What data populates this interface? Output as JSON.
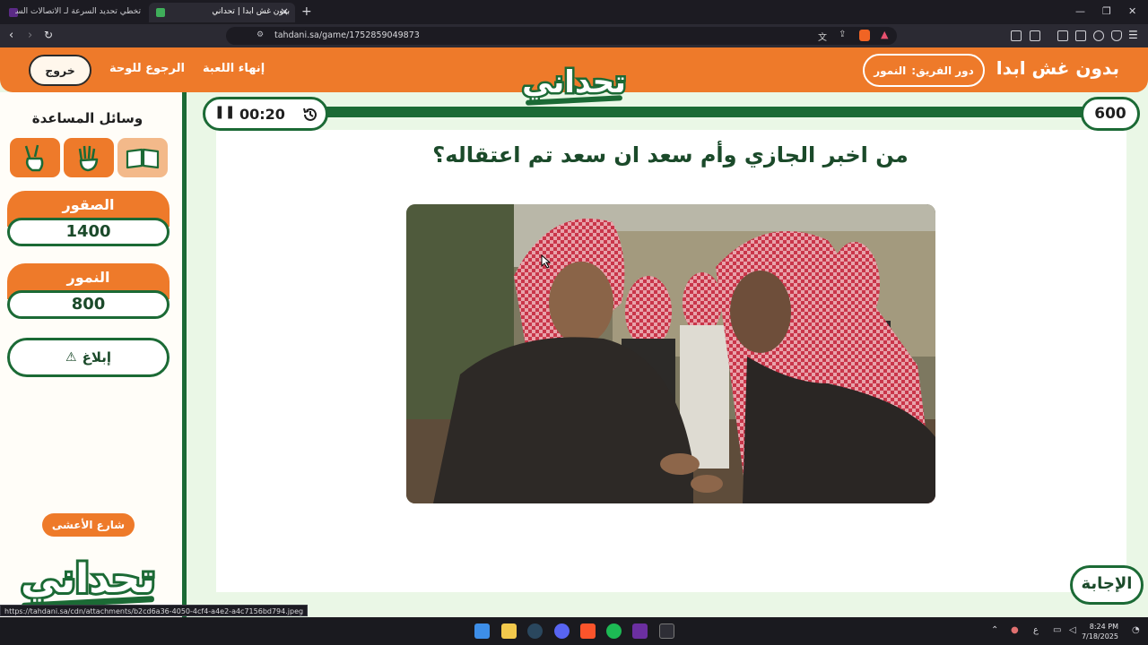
{
  "browser": {
    "tabs": [
      {
        "title": "تخطي تحديد السرعة لـ الاتصالات السعو..",
        "active": false
      },
      {
        "title": "بدون غش ابدا | تحداني",
        "active": true
      }
    ],
    "url": "tahdani.sa/game/1752859049873",
    "status_url": "https://tahdani.sa/cdn/attachments/b2cd6a36-4050-4cf4-a4e2-a4c7156bd794.jpeg"
  },
  "header": {
    "exit_label": "خروج",
    "back_label": "الرجوع للوحة",
    "end_game_label": "إنهاء اللعبة",
    "turn_label": "دور الفريق:",
    "turn_team": "النمور",
    "game_title": "بدون غش ابدا"
  },
  "logo_text": "تحداني",
  "sidebar": {
    "aids_title": "وسائل المساعدة",
    "aids": [
      {
        "name": "two-answers",
        "icon": "peace-hand-icon",
        "used": false
      },
      {
        "name": "call-friend",
        "icon": "raised-hand-icon",
        "used": false
      },
      {
        "name": "double-points",
        "icon": "open-book-icon",
        "used": true
      }
    ],
    "teams": [
      {
        "name": "الصقور",
        "score": "1400"
      },
      {
        "name": "النمور",
        "score": "800"
      }
    ],
    "report_label": "إبلاغ",
    "sponsor": "شارع الأعشى"
  },
  "question": {
    "timer": "00:20",
    "points": "600",
    "text": "من اخبر الجازي وأم سعد ان سعد تم اعتقاله؟",
    "answer_label": "الإجابة"
  },
  "taskbar": {
    "time": "8:24 PM",
    "date": "7/18/2025",
    "lang": "ع"
  },
  "colors": {
    "orange": "#ee7a2a",
    "green": "#1b6a35",
    "page_bg": "#eaf7e6"
  }
}
